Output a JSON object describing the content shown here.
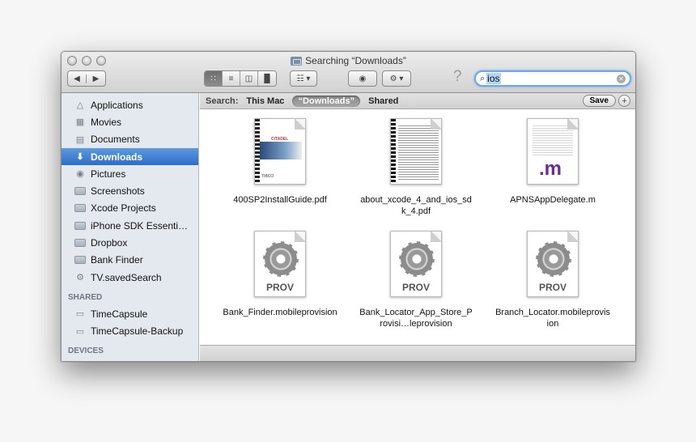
{
  "window": {
    "title": "Searching “Downloads”"
  },
  "toolbar": {
    "nav_back": "◀",
    "nav_forward": "▶",
    "view_icon": "∷",
    "view_list": "≡",
    "view_columns": "◫",
    "view_coverflow": "▐▌",
    "arrange": "☷ ▾",
    "quicklook": "◉",
    "action": "⚙ ▾",
    "help": "?"
  },
  "search": {
    "value": "ios",
    "magnifier": "⌕",
    "clear": "✕"
  },
  "sidebar": {
    "favorites": [
      {
        "label": "Applications",
        "icon": "applications-icon"
      },
      {
        "label": "Movies",
        "icon": "movies-icon"
      },
      {
        "label": "Documents",
        "icon": "documents-icon"
      },
      {
        "label": "Downloads",
        "icon": "downloads-icon",
        "selected": true
      },
      {
        "label": "Pictures",
        "icon": "pictures-icon"
      },
      {
        "label": "Screenshots",
        "icon": "folder-icon"
      },
      {
        "label": "Xcode Projects",
        "icon": "folder-icon"
      },
      {
        "label": "iPhone SDK Essenti…",
        "icon": "folder-icon"
      },
      {
        "label": "Dropbox",
        "icon": "folder-icon"
      },
      {
        "label": "Bank Finder",
        "icon": "folder-icon"
      },
      {
        "label": "TV.savedSearch",
        "icon": "gear-icon"
      }
    ],
    "shared_header": "SHARED",
    "shared": [
      {
        "label": "TimeCapsule",
        "icon": "display-icon"
      },
      {
        "label": "TimeCapsule-Backup",
        "icon": "display-icon"
      }
    ],
    "devices_header": "DEVICES"
  },
  "scope": {
    "label": "Search:",
    "options": [
      "This Mac",
      "“Downloads”",
      "Shared"
    ],
    "selected_index": 1,
    "save_label": "Save",
    "add_label": "+"
  },
  "files": [
    {
      "name": "400SP2InstallGuide.pdf",
      "kind": "pdf-cover",
      "logo": "CITADEL",
      "footer": "TIBCO"
    },
    {
      "name": "about_xcode_4_and_ios_sdk_4.pdf",
      "kind": "pdf-text"
    },
    {
      "name": "APNSAppDelegate.m",
      "kind": "source",
      "badge": ".m"
    },
    {
      "name": "Bank_Finder.mobileprovision",
      "kind": "provision",
      "badge": "PROV"
    },
    {
      "name": "Bank_Locator_App_Store_Provisi…leprovision",
      "kind": "provision",
      "badge": "PROV"
    },
    {
      "name": "Branch_Locator.mobileprovision",
      "kind": "provision",
      "badge": "PROV"
    }
  ]
}
